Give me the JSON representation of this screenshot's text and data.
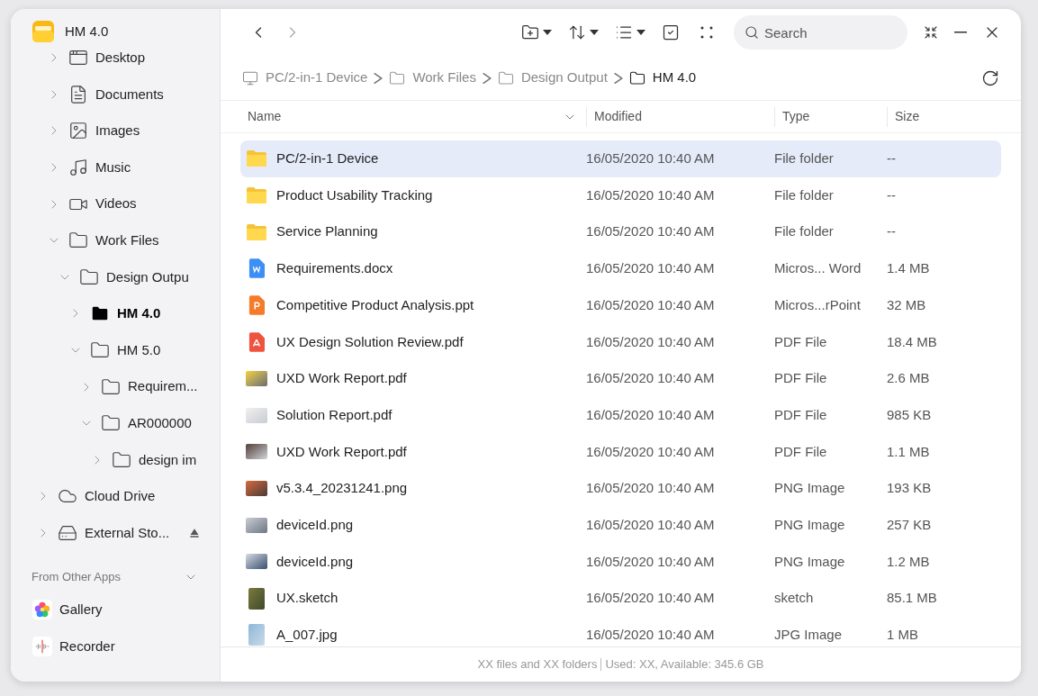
{
  "app": {
    "title": "HM 4.0"
  },
  "sidebar": {
    "device_items": [
      {
        "label": "Desktop",
        "kind": "desktop",
        "expanded": false,
        "selected": false
      },
      {
        "label": "Documents",
        "kind": "document",
        "expanded": false,
        "selected": false
      },
      {
        "label": "Images",
        "kind": "image",
        "expanded": false,
        "selected": false
      },
      {
        "label": "Music",
        "kind": "music",
        "expanded": false,
        "selected": false
      },
      {
        "label": "Videos",
        "kind": "video",
        "expanded": false,
        "selected": false
      },
      {
        "label": "Work Files",
        "kind": "folder",
        "expanded": true,
        "selected": false,
        "children": [
          {
            "label": "Design Outpu",
            "kind": "folder",
            "expanded": true,
            "selected": false,
            "children": [
              {
                "label": "HM 4.0",
                "kind": "folder",
                "expanded": false,
                "selected": true
              },
              {
                "label": "HM 5.0",
                "kind": "folder",
                "expanded": true,
                "selected": false,
                "children": [
                  {
                    "label": "Requirem...",
                    "kind": "folder",
                    "expanded": false,
                    "selected": false
                  },
                  {
                    "label": "AR000000",
                    "kind": "folder",
                    "expanded": true,
                    "selected": false,
                    "children": [
                      {
                        "label": "design im",
                        "kind": "folder",
                        "expanded": false,
                        "selected": false
                      }
                    ]
                  }
                ]
              }
            ]
          }
        ]
      }
    ],
    "locations": [
      {
        "label": "Cloud Drive",
        "kind": "cloud",
        "expanded": false,
        "selected": false
      },
      {
        "label": "External Sto...",
        "kind": "drive",
        "expanded": false,
        "selected": false,
        "ejectable": true
      }
    ],
    "other_apps": {
      "title": "From Other Apps",
      "expanded": true,
      "items": [
        {
          "label": "Gallery",
          "kind": "gallery"
        },
        {
          "label": "Recorder",
          "kind": "recorder"
        }
      ]
    }
  },
  "toolbar": {
    "search": {
      "placeholder": "Search"
    }
  },
  "breadcrumb": [
    {
      "label": "PC/2-in-1 Device",
      "kind": "device",
      "current": false
    },
    {
      "label": "Work Files",
      "kind": "folder",
      "current": false
    },
    {
      "label": "Design Output",
      "kind": "folder",
      "current": false
    },
    {
      "label": "HM 4.0",
      "kind": "folder",
      "current": true
    }
  ],
  "table": {
    "columns": [
      "Name",
      "Modified",
      "Type",
      "Size"
    ],
    "rows": [
      {
        "name": "PC/2-in-1 Device",
        "kind": "folder",
        "modified": "16/05/2020 10:40 AM",
        "type": "File folder",
        "size": "--",
        "selected": true
      },
      {
        "name": "Product Usability Tracking",
        "kind": "folder",
        "modified": "16/05/2020 10:40 AM",
        "type": "File folder",
        "size": "--",
        "selected": false
      },
      {
        "name": "Service Planning",
        "kind": "folder",
        "modified": "16/05/2020 10:40 AM",
        "type": "File folder",
        "size": "--",
        "selected": false
      },
      {
        "name": "Requirements.docx",
        "kind": "word",
        "modified": "16/05/2020 10:40 AM",
        "type": "Micros... Word",
        "size": "1.4 MB",
        "selected": false
      },
      {
        "name": "Competitive Product Analysis.ppt",
        "kind": "ppt",
        "modified": "16/05/2020 10:40 AM",
        "type": "Micros...rPoint",
        "size": "32 MB",
        "selected": false
      },
      {
        "name": "UX Design Solution Review.pdf",
        "kind": "pdf",
        "modified": "16/05/2020 10:40 AM",
        "type": "PDF File",
        "size": "18.4 MB",
        "selected": false
      },
      {
        "name": "UXD Work Report.pdf",
        "kind": "thumbnail",
        "modified": "16/05/2020 10:40 AM",
        "type": "PDF File",
        "size": "2.6 MB",
        "selected": false
      },
      {
        "name": "Solution Report.pdf",
        "kind": "thumbnail",
        "modified": "16/05/2020 10:40 AM",
        "type": "PDF File",
        "size": "985 KB",
        "selected": false
      },
      {
        "name": "UXD Work Report.pdf",
        "kind": "thumbnail",
        "modified": "16/05/2020 10:40 AM",
        "type": "PDF File",
        "size": "1.1 MB",
        "selected": false
      },
      {
        "name": "v5.3.4_20231241.png",
        "kind": "thumbnail",
        "modified": "16/05/2020 10:40 AM",
        "type": "PNG Image",
        "size": "193 KB",
        "selected": false
      },
      {
        "name": "deviceId.png",
        "kind": "thumbnail",
        "modified": "16/05/2020 10:40 AM",
        "type": "PNG Image",
        "size": "257 KB",
        "selected": false
      },
      {
        "name": "deviceId.png",
        "kind": "thumbnail",
        "modified": "16/05/2020 10:40 AM",
        "type": "PNG Image",
        "size": "1.2 MB",
        "selected": false
      },
      {
        "name": "UX.sketch",
        "kind": "thumbnail",
        "modified": "16/05/2020 10:40 AM",
        "type": "sketch",
        "size": "85.1 MB",
        "selected": false
      },
      {
        "name": "A_007.jpg",
        "kind": "thumbnail",
        "modified": "16/05/2020 10:40 AM",
        "type": "JPG Image",
        "size": "1 MB",
        "selected": false
      }
    ]
  },
  "status_bar": {
    "counts": "XX files and XX folders",
    "storage": "Used: XX, Available: 345.6 GB"
  }
}
